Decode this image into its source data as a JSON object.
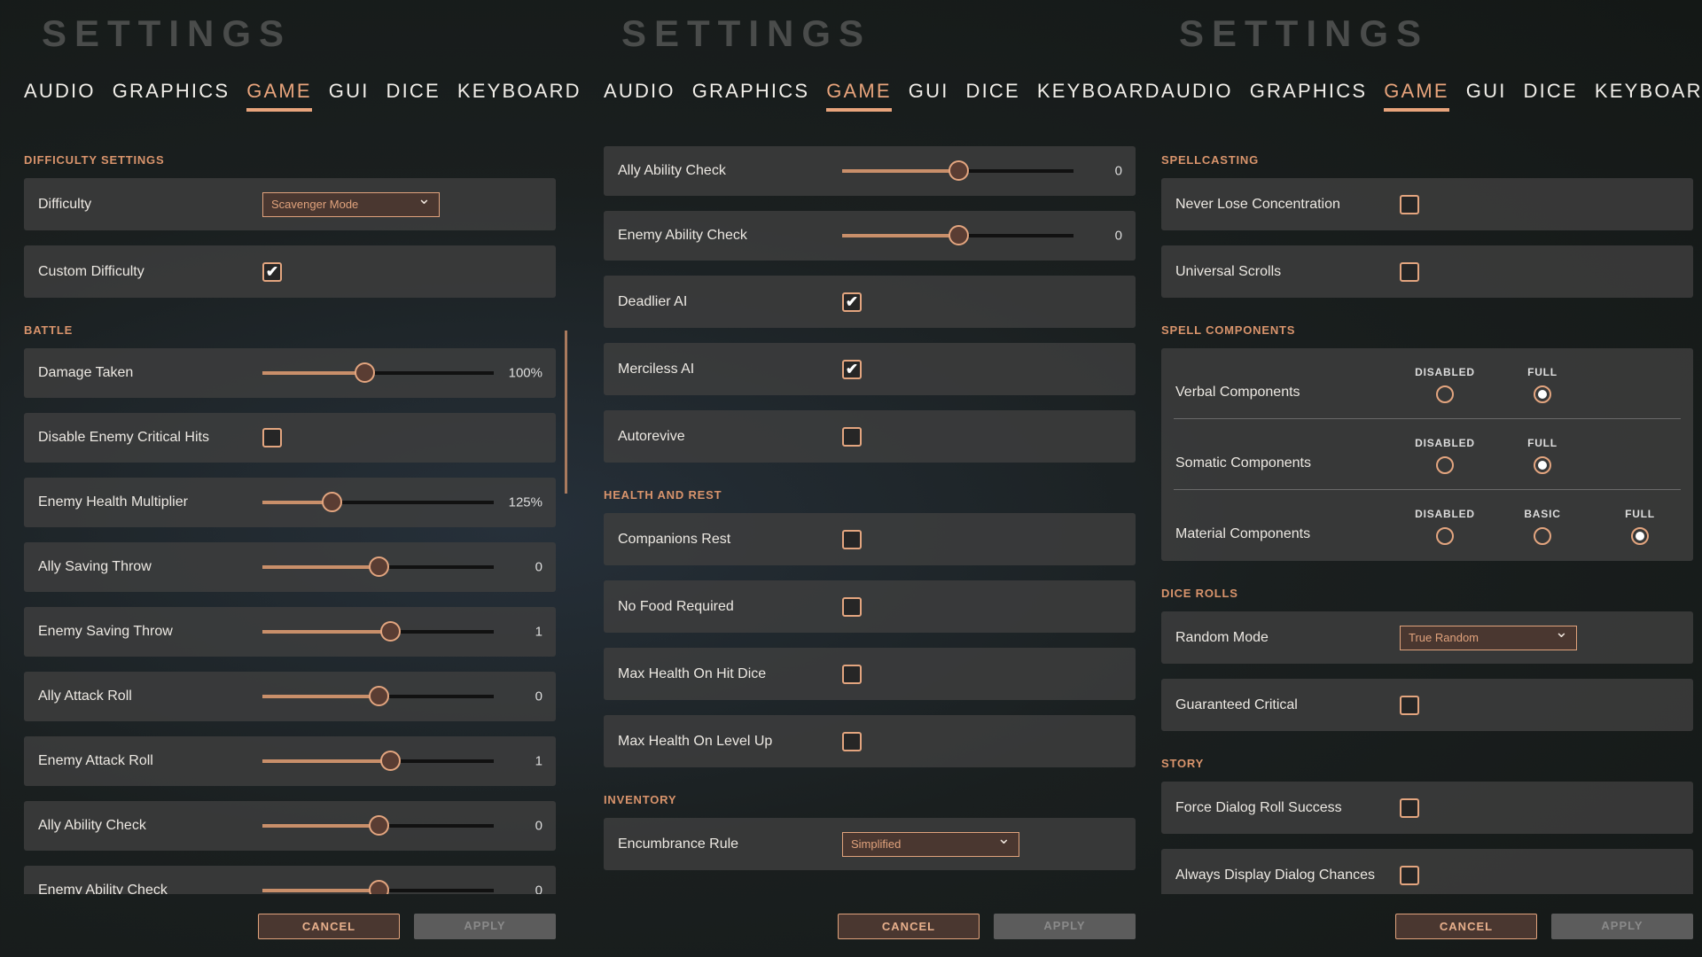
{
  "accent": "#e8a47c",
  "panels": [
    {
      "title": "SETTINGS",
      "tabs": [
        "AUDIO",
        "GRAPHICS",
        "GAME",
        "GUI",
        "DICE",
        "KEYBOARD"
      ],
      "active_tab": "GAME",
      "cancel": "CANCEL",
      "apply": "APPLY",
      "scrollbar": true,
      "items": [
        {
          "type": "section",
          "label": "DIFFICULTY SETTINGS"
        },
        {
          "type": "dropdown",
          "label": "Difficulty",
          "value": "Scavenger Mode"
        },
        {
          "type": "checkbox",
          "label": "Custom Difficulty",
          "checked": true
        },
        {
          "type": "section",
          "label": "BATTLE"
        },
        {
          "type": "slider",
          "label": "Damage Taken",
          "value": "100%",
          "fill": 0.44
        },
        {
          "type": "checkbox",
          "label": "Disable Enemy Critical Hits",
          "checked": false,
          "compact": true
        },
        {
          "type": "slider",
          "label": "Enemy Health Multiplier",
          "value": "125%",
          "fill": 0.3
        },
        {
          "type": "slider",
          "label": "Ally Saving Throw",
          "value": "0",
          "fill": 0.5
        },
        {
          "type": "slider",
          "label": "Enemy Saving Throw",
          "value": "1",
          "fill": 0.55
        },
        {
          "type": "slider",
          "label": "Ally Attack Roll",
          "value": "0",
          "fill": 0.5
        },
        {
          "type": "slider",
          "label": "Enemy Attack Roll",
          "value": "1",
          "fill": 0.55
        },
        {
          "type": "slider",
          "label": "Ally Ability Check",
          "value": "0",
          "fill": 0.5
        },
        {
          "type": "slider",
          "label": "Enemy Ability Check",
          "value": "0",
          "fill": 0.5
        }
      ]
    },
    {
      "title": "SETTINGS",
      "tabs": [
        "AUDIO",
        "GRAPHICS",
        "GAME",
        "GUI",
        "DICE",
        "KEYBOARD"
      ],
      "active_tab": "GAME",
      "cancel": "CANCEL",
      "apply": "APPLY",
      "items": [
        {
          "type": "slider",
          "label": "Ally Ability Check",
          "value": "0",
          "fill": 0.5
        },
        {
          "type": "slider",
          "label": "Enemy Ability Check",
          "value": "0",
          "fill": 0.5
        },
        {
          "type": "checkbox",
          "label": "Deadlier AI",
          "checked": true
        },
        {
          "type": "checkbox",
          "label": "Merciless AI",
          "checked": true
        },
        {
          "type": "checkbox",
          "label": "Autorevive",
          "checked": false
        },
        {
          "type": "section",
          "label": "HEALTH AND REST"
        },
        {
          "type": "checkbox",
          "label": "Companions Rest",
          "checked": false
        },
        {
          "type": "checkbox",
          "label": "No Food Required",
          "checked": false
        },
        {
          "type": "checkbox",
          "label": "Max Health On Hit Dice",
          "checked": false
        },
        {
          "type": "checkbox",
          "label": "Max Health On Level Up",
          "checked": false
        },
        {
          "type": "section",
          "label": "INVENTORY"
        },
        {
          "type": "dropdown",
          "label": "Encumbrance Rule",
          "value": "Simplified"
        }
      ]
    },
    {
      "title": "SETTINGS",
      "tabs": [
        "AUDIO",
        "GRAPHICS",
        "GAME",
        "GUI",
        "DICE",
        "KEYBOARD"
      ],
      "active_tab": "GAME",
      "cancel": "CANCEL",
      "apply": "APPLY",
      "items": [
        {
          "type": "section",
          "label": "SPELLCASTING"
        },
        {
          "type": "checkbox",
          "label": "Never Lose Concentration",
          "checked": false
        },
        {
          "type": "checkbox",
          "label": "Universal Scrolls",
          "checked": false
        },
        {
          "type": "section",
          "label": "SPELL COMPONENTS"
        },
        {
          "type": "radios",
          "rows": [
            {
              "label": "Verbal Components",
              "options": [
                "DISABLED",
                "FULL"
              ],
              "selected": "FULL"
            },
            {
              "label": "Somatic Components",
              "options": [
                "DISABLED",
                "FULL"
              ],
              "selected": "FULL"
            },
            {
              "label": "Material Components",
              "options": [
                "DISABLED",
                "BASIC",
                "FULL"
              ],
              "selected": "FULL"
            }
          ]
        },
        {
          "type": "section",
          "label": "DICE ROLLS"
        },
        {
          "type": "dropdown",
          "label": "Random Mode",
          "value": "True Random"
        },
        {
          "type": "checkbox",
          "label": "Guaranteed Critical",
          "checked": false
        },
        {
          "type": "section",
          "label": "STORY"
        },
        {
          "type": "checkbox",
          "label": "Force Dialog Roll Success",
          "checked": false
        },
        {
          "type": "checkbox",
          "label": "Always Display Dialog Chances",
          "checked": false
        }
      ]
    }
  ]
}
